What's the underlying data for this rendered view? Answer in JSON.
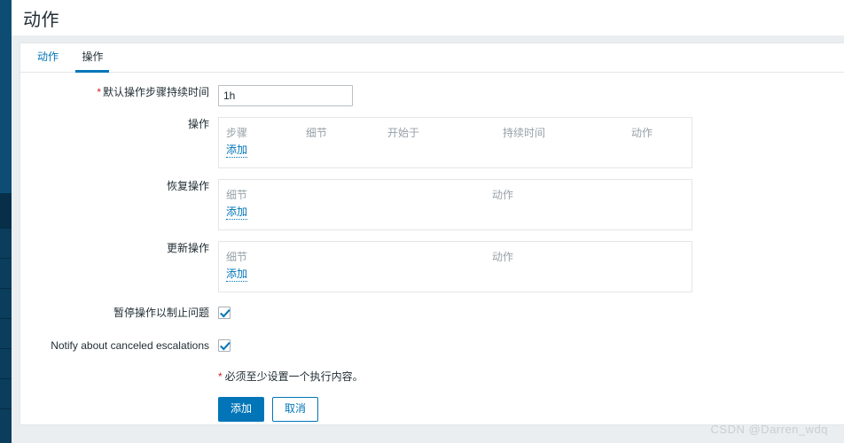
{
  "window": {
    "title": "动作"
  },
  "tabs": [
    {
      "label": "动作",
      "active": false
    },
    {
      "label": "操作",
      "active": true
    }
  ],
  "form": {
    "default_step_duration": {
      "label": "默认操作步骤持续时间",
      "required_marker": "*",
      "value": "1h",
      "placeholder": ""
    },
    "operations": {
      "label": "操作",
      "columns": [
        "步骤",
        "细节",
        "开始于",
        "持续时间",
        "动作"
      ],
      "rows": [],
      "add_link": "添加"
    },
    "recovery_operations": {
      "label": "恢复操作",
      "columns": [
        "细节",
        "动作"
      ],
      "rows": [],
      "add_link": "添加"
    },
    "update_operations": {
      "label": "更新操作",
      "columns": [
        "细节",
        "动作"
      ],
      "rows": [],
      "add_link": "添加"
    },
    "pause_operations": {
      "label": "暂停操作以制止问题",
      "checked": true
    },
    "notify_canceled": {
      "label": "Notify about canceled escalations",
      "checked": true
    }
  },
  "footer": {
    "note_star": "*",
    "note_text": "必须至少设置一个执行内容。",
    "submit_label": "添加",
    "cancel_label": "取消"
  },
  "watermark": {
    "text": "CSDN @Darren_wdq"
  },
  "colors": {
    "accent": "#0275b8",
    "sidebar": "#0d4d74",
    "sidebar_dark": "#0b3d5c",
    "required": "#d31f1f",
    "page_bg": "#ebeef0",
    "muted_text": "#97a1a8",
    "border": "#e3e6e8"
  }
}
